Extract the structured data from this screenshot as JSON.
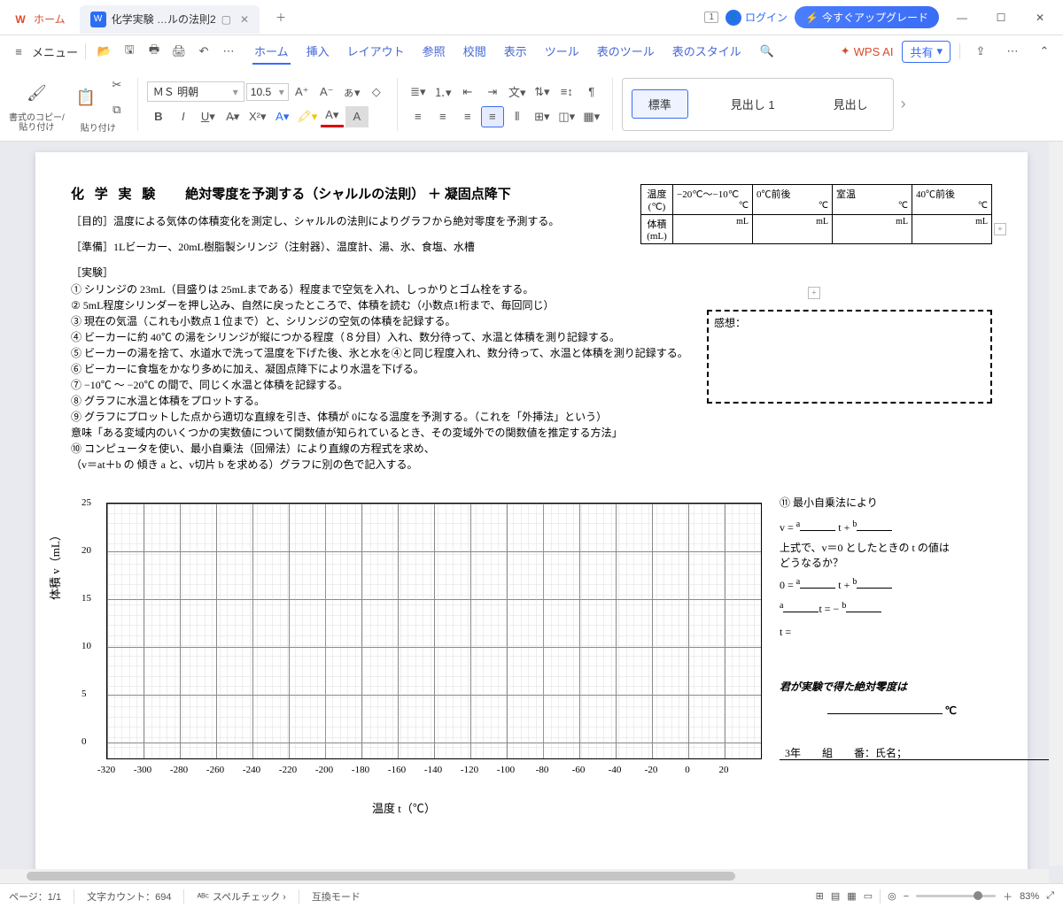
{
  "title_tabs": {
    "home": "ホーム",
    "doc": "化学実験 …ルの法則2"
  },
  "titlebar": {
    "login": "ログイン",
    "upgrade": "今すぐアップグレード"
  },
  "menu": {
    "menu_label": "メニュー",
    "tabs": [
      "ホーム",
      "挿入",
      "レイアウト",
      "参照",
      "校閲",
      "表示",
      "ツール",
      "表のツール",
      "表のスタイル"
    ],
    "wpsai": "WPS AI",
    "share": "共有"
  },
  "ribbon": {
    "copy_paste": "書式のコピー/\n貼り付け",
    "paste": "貼り付け",
    "font_name": "ＭＳ 明朝",
    "font_size": "10.5",
    "style_normal": "標準",
    "style_h1": "見出し 1",
    "style_h2": "見出し"
  },
  "doc": {
    "title_a": "化 学 実 験",
    "title_b": "絶対零度を予測する（シャルルの法則） ＋ 凝固点降下",
    "purpose": "［目的］温度による気体の体積変化を測定し、シャルルの法則によりグラフから絶対零度を予測する。",
    "prep": "［準備］1Lビーカー、20mL樹脂製シリンジ（注射器）、温度計、湯、氷、食塩、水槽",
    "exp_label": "［実験］",
    "steps": [
      "① シリンジの 23mL（目盛りは 25mLまである）程度まで空気を入れ、しっかりとゴム栓をする。",
      "② 5mL程度シリンダーを押し込み、自然に戻ったところで、体積を読む（小数点1桁まで、毎回同じ）",
      "③ 現在の気温（これも小数点１位まで）と、シリンジの空気の体積を記録する。",
      "④ ビーカーに約 40℃ の湯をシリンジが縦につかる程度（８分目）入れ、数分待って、水温と体積を測り記録する。",
      "⑤ ビーカーの湯を捨て、水道水で洗って温度を下げた後、氷と水を④と同じ程度入れ、数分待って、水温と体積を測り記録する。",
      "⑥ ビーカーに食塩をかなり多めに加え、凝固点降下により水温を下げる。",
      "⑦ −10℃ 〜 −20℃ の間で、同じく水温と体積を記録する。",
      "⑧ グラフに水温と体積をプロットする。",
      "⑨ グラフにプロットした点から適切な直線を引き、体積が 0になる温度を予測する。（これを「外挿法」という）",
      "   意味「ある変域内のいくつかの実数値について関数値が知られているとき、その変域外での関数値を推定する方法」",
      "⑩ コンピュータを使い、最小自乗法（回帰法）により直線の方程式を求め、",
      "   （v＝at＋b の 傾き a と、v切片 b を求める）グラフに別の色で記入する。"
    ],
    "table": {
      "row1_label": "温度\n(℃)",
      "row2_label": "体積\n(mL)",
      "cols": [
        "−20℃〜−10℃",
        "0℃前後",
        "室温",
        "40℃前後"
      ],
      "unit_c": "℃",
      "unit_ml": "mL"
    },
    "impress": "感想：",
    "calc": {
      "head": "⑪ 最小自乗法により",
      "eq1_pre": "v = ",
      "eq1_mid": " t + ",
      "q": "上式で、v＝0 としたときの t の値はどうなるか？",
      "eq2": "0 = ",
      "eq3a": "t = − ",
      "eq4": "t =",
      "sign": "君が実験で得た絶対零度は",
      "deg": "℃"
    },
    "footer": "3年　　組　　番：氏名；"
  },
  "chart_data": {
    "type": "scatter",
    "title": "",
    "xlabel": "温度 t（℃）",
    "ylabel": "体積 v（mL）",
    "xlim": [
      -320,
      20
    ],
    "ylim": [
      0,
      25
    ],
    "xticks": [
      -320,
      -300,
      -280,
      -260,
      -240,
      -220,
      -200,
      -180,
      -160,
      -140,
      -120,
      -100,
      -80,
      -60,
      -40,
      -20,
      0,
      20
    ],
    "yticks": [
      0,
      5,
      10,
      15,
      20,
      25
    ],
    "series": []
  },
  "status": {
    "page": "ページ：1/1",
    "count": "文字カウント：694",
    "spell": "スペルチェック",
    "compat": "互換モード",
    "zoom": "83%"
  }
}
